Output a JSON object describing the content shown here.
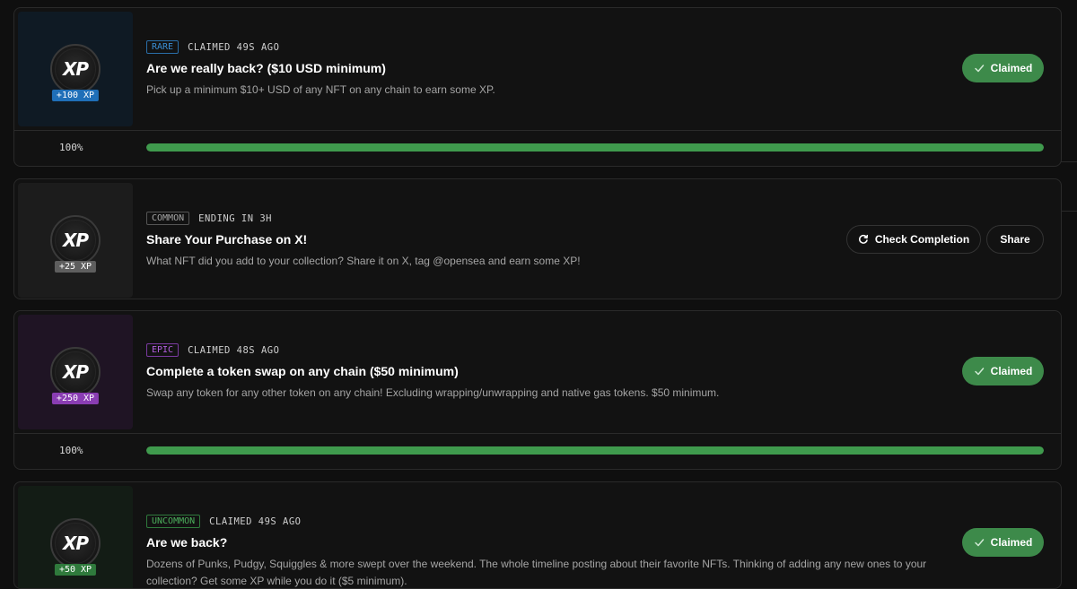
{
  "coin_label": "XP",
  "colors": {
    "rare": "#3a8fd6",
    "common": "#8a8a8a",
    "epic": "#a24fd0",
    "uncommon": "#3f9a4d",
    "claimed_button": "#3d8a4a",
    "progress": "#3f9a4d"
  },
  "quests": [
    {
      "rarity": "RARE",
      "status": "CLAIMED 49S AGO",
      "title": "Are we really back? ($10 USD minimum)",
      "description": "Pick up a minimum $10+ USD of any NFT on any chain to earn some XP.",
      "xp": "+100 XP",
      "button": "Claimed",
      "progress_label": "100%",
      "progress": 1.0
    },
    {
      "rarity": "COMMON",
      "status": "ENDING IN 3H",
      "title": "Share Your Purchase on X!",
      "description": "What NFT did you add to your collection? Share it on X, tag @opensea and earn some XP!",
      "xp": "+25 XP",
      "check_button": "Check Completion",
      "share_button": "Share"
    },
    {
      "rarity": "EPIC",
      "status": "CLAIMED 48S AGO",
      "title": "Complete a token swap on any chain ($50 minimum)",
      "description": "Swap any token for any other token on any chain! Excluding wrapping/unwrapping and native gas tokens. $50 minimum.",
      "xp": "+250 XP",
      "button": "Claimed",
      "progress_label": "100%",
      "progress": 1.0
    },
    {
      "rarity": "UNCOMMON",
      "status": "CLAIMED 49S AGO",
      "title": "Are we back?",
      "description": "Dozens of Punks, Pudgy, Squiggles & more swept over the weekend. The whole timeline posting about their favorite NFTs. Thinking of adding any new ones to your collection? Get some XP while you do it ($5 minimum).",
      "xp": "+50 XP",
      "button": "Claimed"
    }
  ]
}
